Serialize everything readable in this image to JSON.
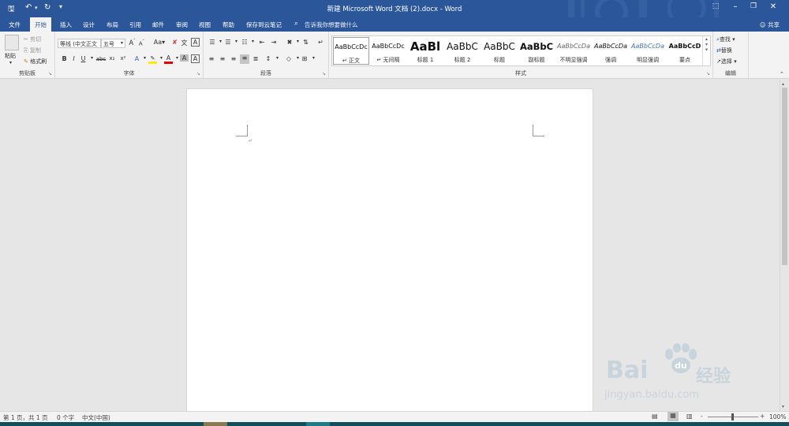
{
  "titlebar": {
    "title": "新建 Microsoft Word 文档 (2).docx - Word",
    "save_icon": "save-icon",
    "undo_icon": "undo-icon",
    "redo_icon": "redo-icon",
    "customize_icon": "customize-qat-icon"
  },
  "tabs": [
    "文件",
    "开始",
    "插入",
    "设计",
    "布局",
    "引用",
    "邮件",
    "审阅",
    "视图",
    "帮助",
    "保存到云笔记"
  ],
  "active_tab": "开始",
  "tell_me": "告诉我你想要做什么",
  "share": "共享",
  "ribbon": {
    "clipboard": {
      "label": "剪贴板",
      "paste": "粘贴",
      "cut": "剪切",
      "copy": "复制",
      "format_painter": "格式刷"
    },
    "font": {
      "label": "字体",
      "font_name": "等线 (中文正文",
      "font_size": "五号",
      "grow": "A",
      "shrink": "A",
      "change_case": "Aa",
      "bold": "B",
      "italic": "I",
      "underline": "U",
      "strike": "abc",
      "subscript": "x₂",
      "superscript": "x²",
      "font_color": "A",
      "char_shading": "A",
      "char_border": "A"
    },
    "paragraph": {
      "label": "段落"
    },
    "styles": {
      "label": "样式",
      "items": [
        {
          "preview": "AaBbCcDc",
          "name": "正文"
        },
        {
          "preview": "AaBbCcDc",
          "name": "无间隔"
        },
        {
          "preview": "AaBl",
          "name": "标题 1"
        },
        {
          "preview": "AaBbC",
          "name": "标题 2"
        },
        {
          "preview": "AaBbC",
          "name": "标题"
        },
        {
          "preview": "AaBbC",
          "name": "副标题"
        },
        {
          "preview": "AaBbCcDa",
          "name": "不明显强调"
        },
        {
          "preview": "AaBbCcDa",
          "name": "强调"
        },
        {
          "preview": "AaBbCcDa",
          "name": "明显强调"
        },
        {
          "preview": "AaBbCcD",
          "name": "要点"
        }
      ]
    },
    "editing": {
      "label": "编辑",
      "find": "查找",
      "replace": "替换",
      "select": "选择"
    }
  },
  "status": {
    "page": "第 1 页，共 1 页",
    "words": "0 个字",
    "language": "中文(中国)",
    "zoom": "100%",
    "zoom_minus": "-",
    "zoom_plus": "+"
  },
  "watermark": {
    "text": "Bai",
    "text2": "经验",
    "url": "jingyan.baidu.com"
  },
  "colors": {
    "accent": "#2b579a",
    "ribbon_bg": "#f3f3f3",
    "workspace": "#e6e6e6",
    "taskbar": "#134e5e"
  }
}
